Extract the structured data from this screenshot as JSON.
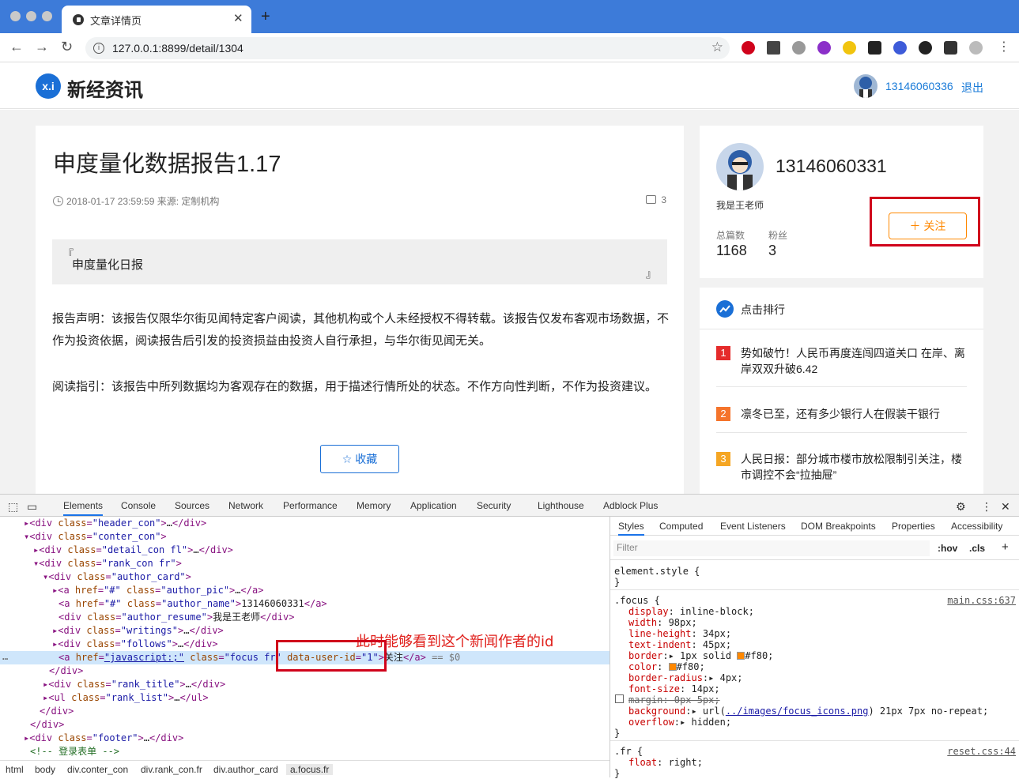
{
  "browser": {
    "tab_title": "文章详情页",
    "close": "✕",
    "newtab": "+",
    "url": "127.0.0.1:8899/detail/1304",
    "back": "←",
    "forward": "→",
    "reload": "↻",
    "star": "☆"
  },
  "site": {
    "logo_mark": "x.i",
    "logo_text": "新经资讯",
    "user": "13146060336",
    "logout": "退出"
  },
  "article": {
    "title": "申度量化数据报告1.17",
    "meta": "2018-01-17 23:59:59 来源: 定制机构",
    "comments": "3",
    "quote_open": "『",
    "quote_text": "申度量化日报",
    "quote_close": "』",
    "para1": "报告声明：该报告仅限华尔街见闻特定客户阅读，其他机构或个人未经授权不得转载。该报告仅发布客观市场数据，不作为投资依据，阅读报告后引发的投资损益由投资人自行承担，与华尔街见闻无关。",
    "para2": "阅读指引：该报告中所列数据均为客观存在的数据，用于描述行情所处的状态。不作方向性判断，不作为投资建议。",
    "collect": "☆ 收藏"
  },
  "author": {
    "name": "13146060331",
    "resume": "我是王老师",
    "writings_label": "总篇数",
    "writings": "1168",
    "follows_label": "粉丝",
    "follows": "3",
    "focus": "＋ 关注"
  },
  "rank": {
    "title": "点击排行",
    "items": [
      {
        "num": "1",
        "text": "势如破竹！人民币再度连闯四道关口 在岸、离岸双双升破6.42",
        "color": "#e52b2b"
      },
      {
        "num": "2",
        "text": "凛冬已至，还有多少银行人在假装干银行",
        "color": "#f5742b"
      },
      {
        "num": "3",
        "text": "人民日报：部分城市楼市放松限制引关注，楼市调控不会“拉抽屉”",
        "color": "#f5a623"
      }
    ]
  },
  "devtools": {
    "tabs": [
      "Elements",
      "Console",
      "Sources",
      "Network",
      "Performance",
      "Memory",
      "Application",
      "Security",
      "Lighthouse",
      "Adblock Plus"
    ],
    "annotation": "此时能够看到这个新闻作者的id",
    "crumbs": [
      "html",
      "body",
      "div.conter_con",
      "div.rank_con.fr",
      "div.author_card",
      "a.focus.fr"
    ],
    "style_tabs": [
      "Styles",
      "Computed",
      "Event Listeners",
      "DOM Breakpoints",
      "Properties",
      "Accessibility"
    ],
    "filter_placeholder": "Filter",
    "hov": ":hov",
    "cls": ".cls",
    "plus": "+",
    "selected_suffix": " == $0",
    "dots": "…"
  }
}
